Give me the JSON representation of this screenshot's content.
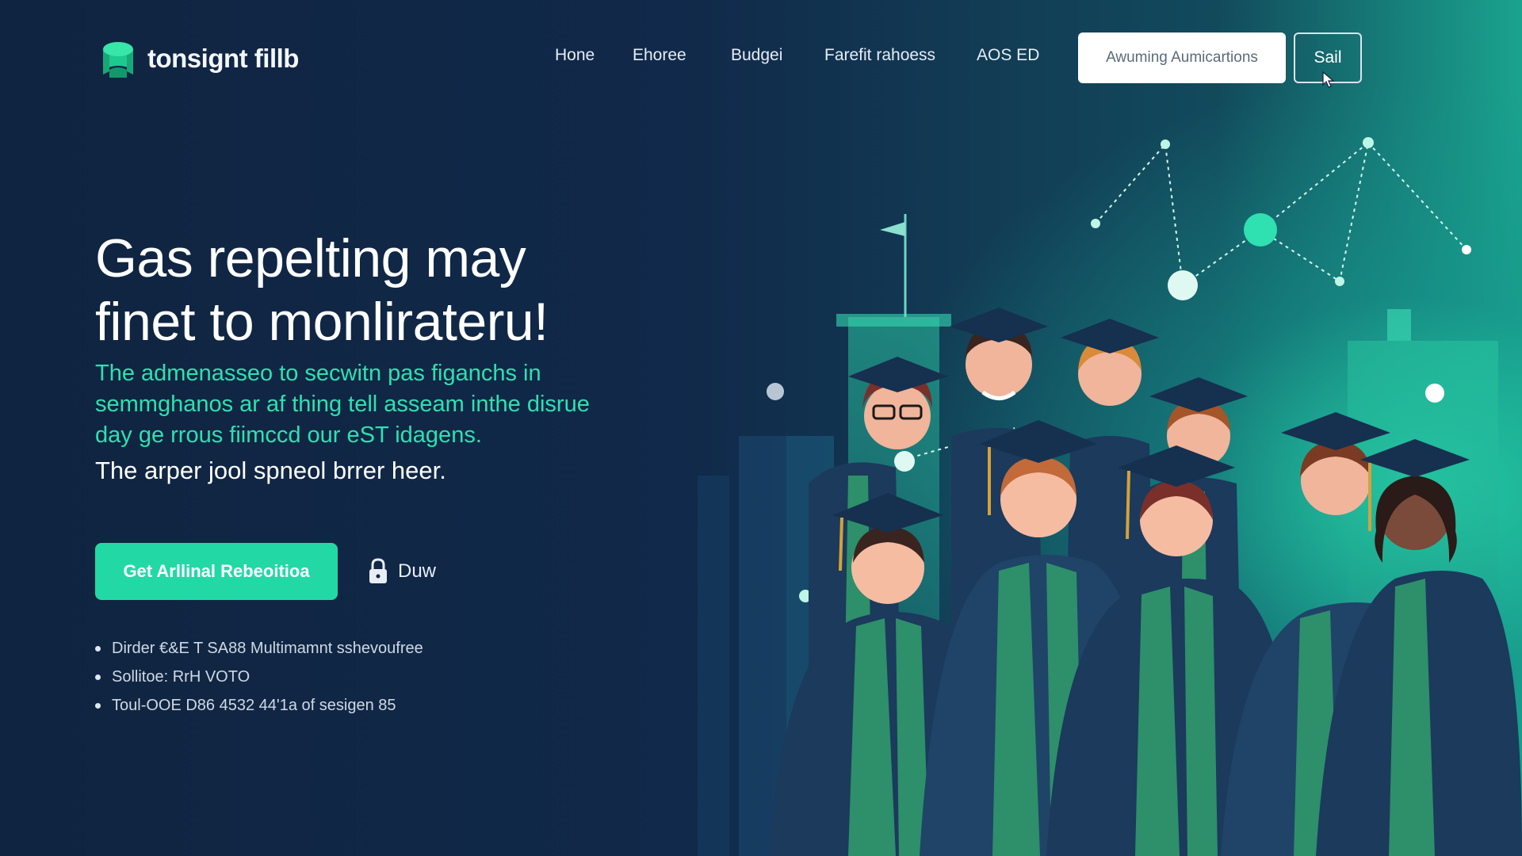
{
  "header": {
    "logo_text": "tonsignt fillb",
    "nav": [
      "Hone",
      "Ehoree",
      "Budgei",
      "Farefit rahoess",
      "AOS ED"
    ],
    "cta_label": "Awuming Aumicartions",
    "sail_label": "Sail"
  },
  "hero": {
    "title_lines": [
      "Gas repelting may",
      "finet to monlirateru!"
    ],
    "subtitle_lines": [
      "The admenasseo to secwitn pas figanchs in",
      "semmghanos ar af thing tell asseam inthe disrue",
      "day ge rrous fiimccd our eST idagens."
    ],
    "tagline": "The arper jool spneol brrer heer.",
    "primary_button": "Get Arllinal Rebeoitioa",
    "secondary_button": "Duw",
    "bullets": [
      "Dirder €&E T SA88 Multimamnt sshevoufree",
      "Sollitoe: RrH VOTO",
      "Toul-OOE D86 4532 44'1a of sesigen 85"
    ]
  },
  "colors": {
    "background": "#0f2440",
    "accent": "#22d9a6",
    "subtitle": "#2fe0b0",
    "gown": "#1b3a5c",
    "stole": "#2e8f6b"
  },
  "icons": {
    "logo": "graduation-cap-logo-icon",
    "lock": "lock-icon",
    "cursor": "mouse-pointer-icon"
  }
}
